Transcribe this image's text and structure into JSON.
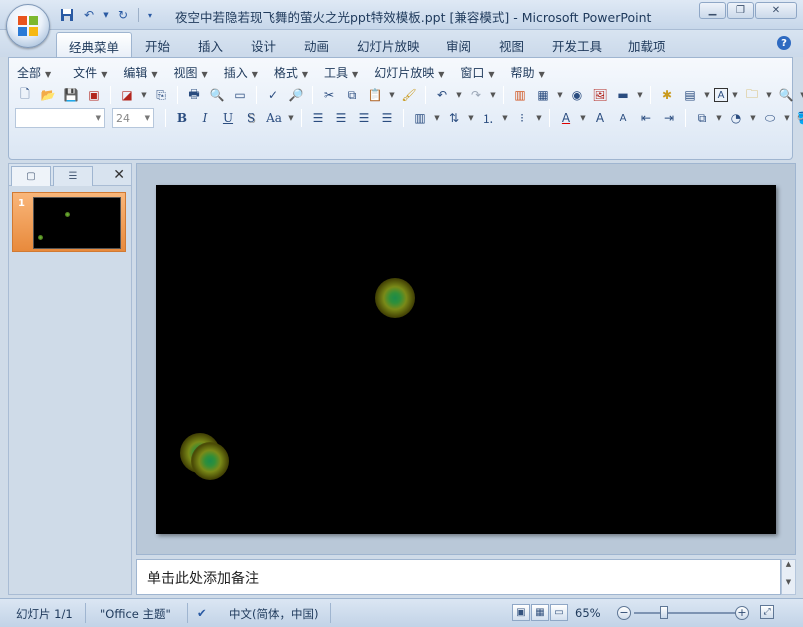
{
  "window": {
    "title": "夜空中若隐若现飞舞的萤火之光ppt特效模板.ppt [兼容模式] - Microsoft PowerPoint"
  },
  "ribbon_tabs": [
    "经典菜单",
    "开始",
    "插入",
    "设计",
    "动画",
    "幻灯片放映",
    "审阅",
    "视图",
    "开发工具",
    "加载项"
  ],
  "menus": [
    "全部",
    "文件",
    "编辑",
    "视图",
    "插入",
    "格式",
    "工具",
    "幻灯片放映",
    "窗口",
    "帮助"
  ],
  "toolbar": {
    "font_name": "",
    "font_size": "24",
    "format_buttons": [
      "B",
      "I",
      "U",
      "S",
      "Aa"
    ]
  },
  "slide_panel": {
    "slides": [
      {
        "number": "1"
      }
    ]
  },
  "notes_placeholder": "单击此处添加备注",
  "status": {
    "slide_info": "幻灯片 1/1",
    "theme": "\"Office 主题\"",
    "language": "中文(简体，中国)",
    "zoom": "65%"
  },
  "colors": {
    "slide_background": "#000000",
    "firefly_core": "#1c8a4b",
    "firefly_glow": "#7a8a18",
    "accent": "#1e395b"
  }
}
